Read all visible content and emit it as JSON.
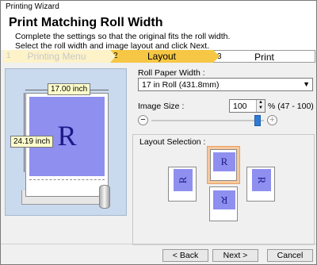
{
  "window": {
    "title": "Printing Wizard"
  },
  "header": {
    "title": "Print Matching Roll Width",
    "line1": "Complete the settings so that the original fits the roll width.",
    "line2": "Select the roll width and image layout and click Next."
  },
  "steps": [
    {
      "num": "1",
      "label": "Printing Menu"
    },
    {
      "num": "2",
      "label": "Layout"
    },
    {
      "num": "3",
      "label": "Print"
    }
  ],
  "preview": {
    "width_label": "17.00 inch",
    "height_label": "24.19 inch",
    "image_letter": "R"
  },
  "roll_width": {
    "label": "Roll Paper Width :",
    "value": "17 in Roll (431.8mm)"
  },
  "image_size": {
    "label": "Image Size :",
    "value": "100",
    "range": "% (47 - 100)",
    "level_percent": 100
  },
  "layout_selection": {
    "label": "Layout Selection :",
    "letter": "R"
  },
  "buttons": {
    "back": "< Back",
    "next": "Next >",
    "cancel": "Cancel"
  },
  "colors": {
    "active_step": "#f6c744",
    "image_fill": "#8f8ff0",
    "preview_bg": "#c9d9ee",
    "selected_layout": "#f7c89a"
  }
}
